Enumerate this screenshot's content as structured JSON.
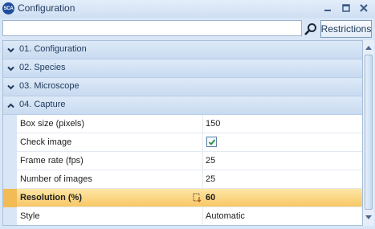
{
  "window": {
    "app_icon": "SCA",
    "title": "Configuration",
    "controls": {
      "minimize": "minimize-icon",
      "maximize": "maximize-icon",
      "close": "close-icon"
    }
  },
  "search": {
    "value": "",
    "placeholder": "",
    "search_icon": "search-icon",
    "restrictions_label": "Restrictions"
  },
  "categories": [
    {
      "label": "01. Configuration",
      "expanded": false
    },
    {
      "label": "02. Species",
      "expanded": false
    },
    {
      "label": "03. Microscope",
      "expanded": false
    },
    {
      "label": "04. Capture",
      "expanded": true
    }
  ],
  "capture_properties": [
    {
      "name": "Box size (pixels)",
      "value": "150"
    },
    {
      "name": "Check image",
      "value": "",
      "checked": true
    },
    {
      "name": "Frame rate (fps)",
      "value": "25"
    },
    {
      "name": "Number of images",
      "value": "25"
    },
    {
      "name": "Resolution (%)",
      "value": "60",
      "selected": true
    },
    {
      "name": "Style",
      "value": "Automatic"
    }
  ],
  "colors": {
    "selected_row": "#f8c765",
    "category_band": "#cfdff3",
    "title_text": "#1e395b"
  }
}
